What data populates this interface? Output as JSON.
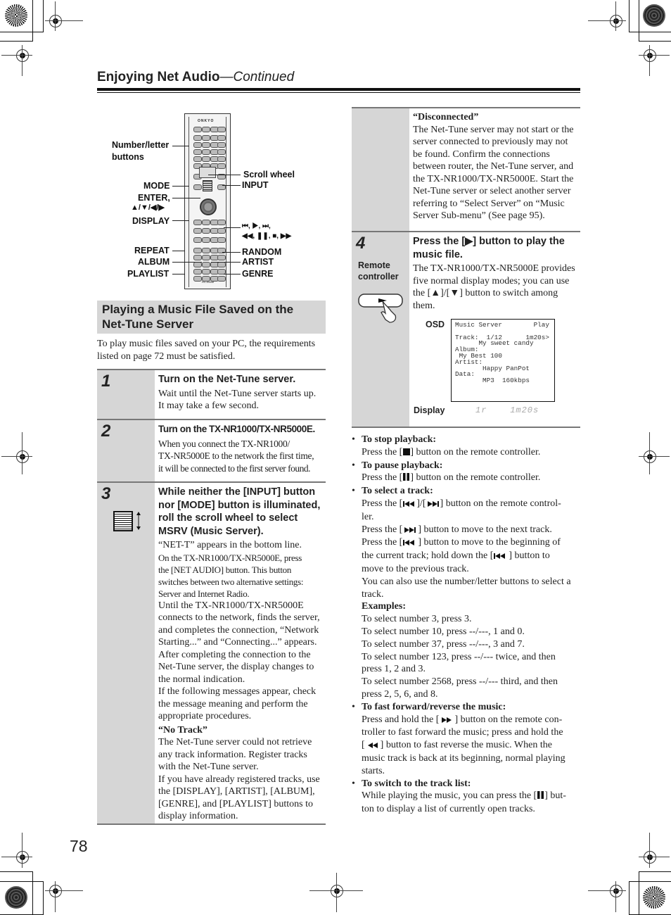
{
  "header": {
    "title": "Enjoying Net Audio",
    "continued": "—Continued"
  },
  "remote_diagram": {
    "brand": "ONKYO",
    "model": "RC-555M",
    "labels_left": {
      "number_letter_1": "Number/letter",
      "number_letter_2": "buttons",
      "mode": "MODE",
      "enter_1": "ENTER,",
      "enter_2": "▲/▼/◀/▶",
      "display": "DISPLAY",
      "repeat": "REPEAT",
      "album": "ALBUM",
      "playlist": "PLAYLIST"
    },
    "labels_right": {
      "scroll_wheel": "Scroll wheel",
      "input": "INPUT",
      "transport_1": "⏮, ▶, ⏭,",
      "transport_2": "◀◀, ❚❚, ■, ▶▶",
      "random": "RANDOM",
      "artist": "ARTIST",
      "genre": "GENRE"
    }
  },
  "section": {
    "heading_1": "Playing a Music File Saved on the",
    "heading_2": "Net-Tune Server",
    "intro_1": "To play music files saved on your PC, the requirements",
    "intro_2": "listed on page 72 must be satisfied."
  },
  "steps": [
    {
      "number": "1",
      "title": "Turn on the Net-Tune server.",
      "lines": [
        "Wait until the Net-Tune server starts up.",
        "It may take a few second."
      ]
    },
    {
      "number": "2",
      "title": "Turn on the TX-NR1000/TX-NR5000E.",
      "lines": [
        "When you connect the TX-NR1000/",
        "TX-NR5000E to the network the first time,",
        "it will be connected to the first server found."
      ]
    },
    {
      "number": "3",
      "title_lines": [
        "While neither the [INPUT] button",
        "nor [MODE] button is illuminated,",
        "roll the scroll wheel to select",
        "MSRV (Music Server)."
      ],
      "lines": [
        "“NET-T” appears in the bottom line.",
        "On the TX-NR1000/TX-NR5000E, press",
        "the [NET AUDIO] button. This button",
        "switches between two alternative settings:",
        "Server and Internet Radio.",
        "Until the TX-NR1000/TX-NR5000E",
        "connects to the network, finds the server,",
        "and completes the connection, “Network",
        "Starting...” and “Connecting...” appears.",
        "After completing the connection to the",
        "Net-Tune server, the display changes to",
        "the normal indication.",
        "If the following messages appear, check",
        "the message meaning and perform the",
        "appropriate procedures."
      ],
      "msg1_title": "“No Track”",
      "msg1_lines": [
        "The Net-Tune server could not retrieve",
        "any track information. Register tracks",
        "with the Net-Tune server.",
        "If you have already registered tracks, use",
        "the [DISPLAY], [ARTIST], [ALBUM],",
        "[GENRE], and [PLAYLIST] buttons to",
        "display information."
      ],
      "msg2_title": "“Disconnected”",
      "msg2_lines": [
        "The Net-Tune server may not start or the",
        "server connected to previously may not",
        "be found. Confirm the connections",
        "between router, the Net-Tune server, and",
        "the TX-NR1000/TX-NR5000E. Start the",
        "Net-Tune server or select another server",
        "referring to “Select Server” on “Music",
        "Server Sub-menu” (See page 95)."
      ]
    },
    {
      "number": "4",
      "side_label_1": "Remote",
      "side_label_2": "controller",
      "title_lines": [
        "Press the [▶] button to play the",
        "music file."
      ],
      "lines": [
        "The TX-NR1000/TX-NR5000E provides",
        "five normal display modes; you can use",
        "the [▲]/[▼] button to switch among",
        "them."
      ]
    }
  ],
  "osd": {
    "label": "OSD",
    "text": "Music Server        Play\n\nTrack:  1/12      1m20s>\n      My sweet candy\nAlbum:\n My Best 100\nArtist:\n       Happy PanPot\nData:\n       MP3  160kbps",
    "display_label": "Display",
    "display_value": "1r    1m20s"
  },
  "bullets": [
    {
      "heading": "To stop playback:",
      "lines": [
        [
          "Press the [",
          "stop",
          "] button on the remote controller."
        ]
      ]
    },
    {
      "heading": "To pause playback:",
      "lines": [
        [
          "Press the [",
          "pause",
          "] button on the remote controller."
        ]
      ]
    },
    {
      "heading": "To select a track:",
      "text": {
        "l1a": "Press the [",
        "l1b": "]/[",
        "l1c": "] button on the remote control-",
        "l2": "ler.",
        "l3a": "Press the [",
        "l3b": "] button to move to the next track.",
        "l4a": "Press the [",
        "l4b": "] button to move to the beginning of",
        "l5a": "the current track; hold down the [",
        "l5b": "] button to",
        "l6": "move to the previous track.",
        "l7": "You can also use the number/letter buttons to select a",
        "l8": "track.",
        "examples": "Examples:",
        "e1": "To select number 3, press 3.",
        "e2": "To select number 10, press --/---, 1 and 0.",
        "e3": "To select number 37, press --/---, 3 and 7.",
        "e4": "To select number 123, press --/--- twice, and then",
        "e5": "press 1, 2 and 3.",
        "e6": "To select number 2568, press --/--- third, and then",
        "e7": "press 2, 5, 6, and 8."
      }
    },
    {
      "heading": "To fast forward/reverse the music:",
      "text": {
        "l1a": "Press and hold the [",
        "l1b": "] button on the remote con-",
        "l2": "troller to fast forward the music; press and hold the",
        "l3a": "[",
        "l3b": "] button to fast reverse the music. When the",
        "l4": "music track is back at its beginning, normal playing",
        "l5": "starts."
      }
    },
    {
      "heading": "To switch to the track list:",
      "text": {
        "l1a": "While playing the music, you can press the [",
        "l1b": "] but-",
        "l2": "ton to display a list of currently open tracks."
      }
    }
  ],
  "page_number": "78"
}
